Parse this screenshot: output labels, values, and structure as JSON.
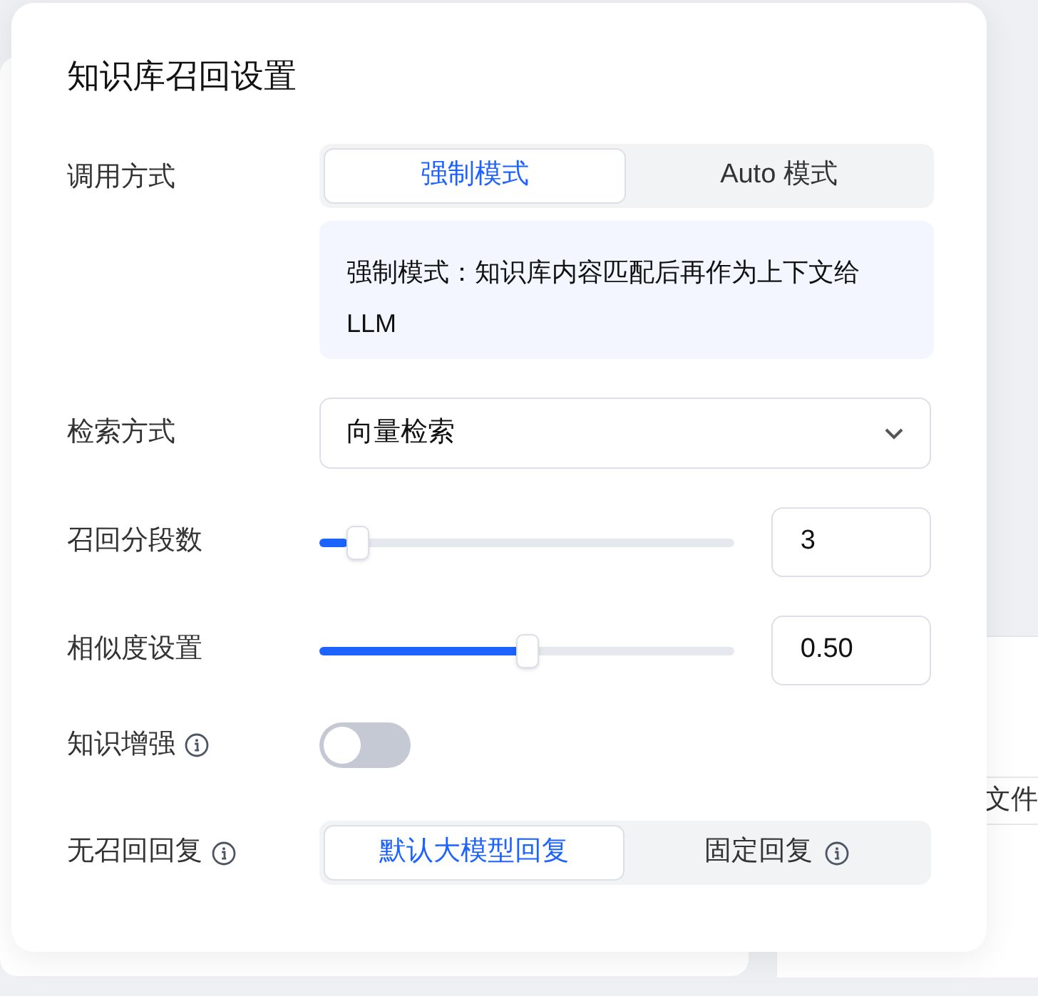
{
  "background": {
    "right_card_text": "文件"
  },
  "dialog": {
    "title": "知识库召回设置",
    "call_mode": {
      "label": "调用方式",
      "options": [
        {
          "label": "强制模式",
          "selected": true
        },
        {
          "label": "Auto 模式",
          "selected": false
        }
      ],
      "description": "强制模式：知识库内容匹配后再作为上下文给LLM"
    },
    "search_mode": {
      "label": "检索方式",
      "value": "向量检索"
    },
    "sliders": [
      {
        "label": "召回分段数",
        "level": 0.07,
        "value": "3"
      },
      {
        "label": "相似度设置",
        "level": 0.5,
        "value": "0.50"
      }
    ],
    "enhance": {
      "label": "知识增强",
      "info": true,
      "on": false
    },
    "no_recall": {
      "label": "无召回回复",
      "info": true,
      "options": [
        {
          "label": "默认大模型回复",
          "selected": true,
          "info": false
        },
        {
          "label": "固定回复",
          "selected": false,
          "info": true
        }
      ]
    }
  }
}
